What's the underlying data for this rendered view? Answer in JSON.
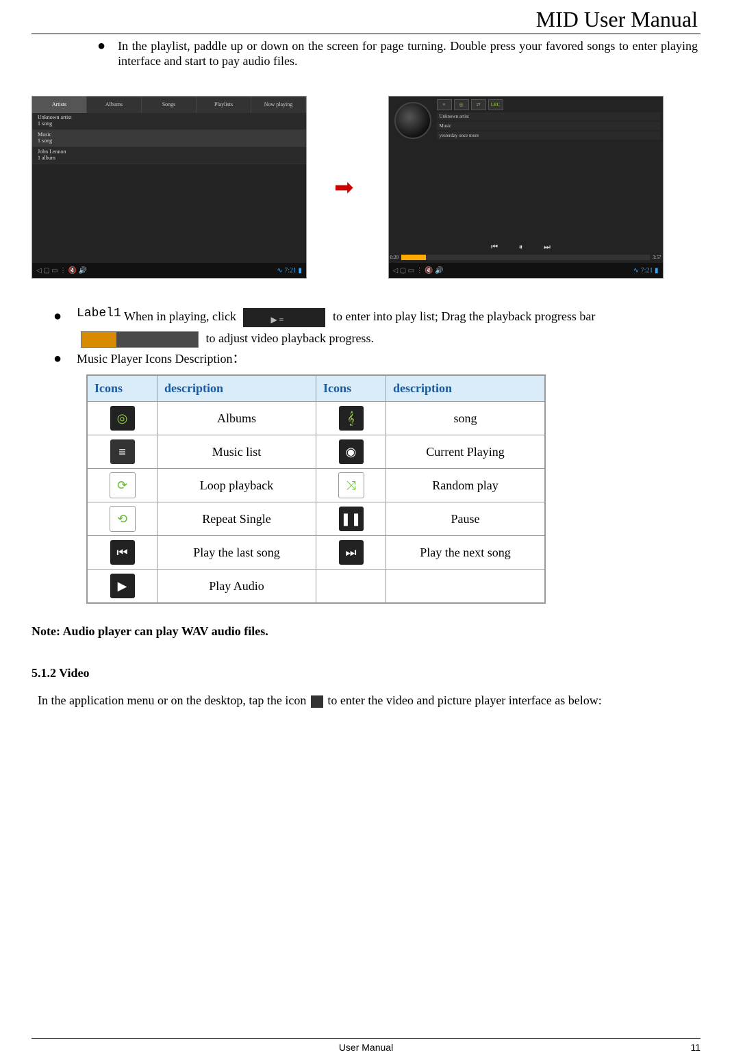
{
  "header_title": "MID User Manual",
  "bullet1": "In the playlist, paddle up or down on the screen for page turning. Double press your favored songs to enter playing interface and start to pay audio files.",
  "screen1": {
    "tabs": [
      "Artists",
      "Albums",
      "Songs",
      "Playlists",
      "Now playing"
    ],
    "rows": [
      {
        "t": "Unknown artist",
        "s": "1 song"
      },
      {
        "t": "Music",
        "s": "1 song"
      },
      {
        "t": "John Lennon",
        "s": "1 album"
      }
    ],
    "time": "7:21"
  },
  "screen2": {
    "btns": [
      "≡",
      "◎",
      "⇄",
      "LRC"
    ],
    "lines": [
      "Unknown artist",
      "Music",
      "yesterday once more"
    ],
    "left_time": "0:20",
    "right_time": "3:57",
    "time": "7:21"
  },
  "bullet2": {
    "label": "Label1",
    "t1": "When in playing, click",
    "t2": "to enter into play list; Drag the playback progress bar",
    "t3": "to adjust video playback progress."
  },
  "bullet3": "Music Player Icons Description：",
  "table": {
    "h1": "Icons",
    "h2": "description",
    "h3": "Icons",
    "h4": "description",
    "rows": [
      {
        "d1": "Albums",
        "d2": "song"
      },
      {
        "d1": "Music list",
        "d2": "Current Playing"
      },
      {
        "d1": "Loop playback",
        "d2": "Random play"
      },
      {
        "d1": "Repeat Single",
        "d2": "Pause"
      },
      {
        "d1": "Play the last song",
        "d2": "Play the next song"
      },
      {
        "d1": "Play Audio",
        "d2": ""
      }
    ]
  },
  "note": "Note: Audio player can play WAV audio files.",
  "section": "5.1.2 Video",
  "bodytext_a": "In the application menu or on the desktop, tap the icon",
  "bodytext_b": "to enter the video and picture player interface as below:",
  "footer_center": "User Manual",
  "footer_page": "11"
}
